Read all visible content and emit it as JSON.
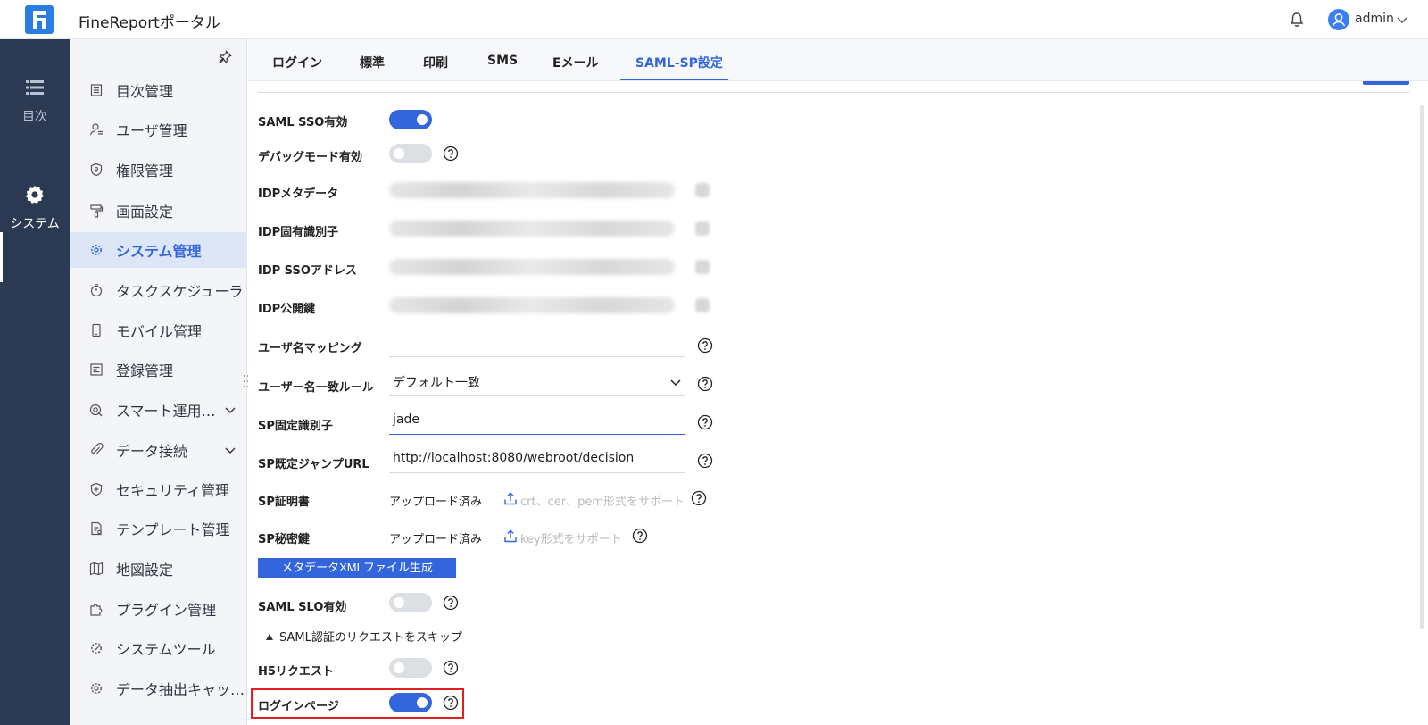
{
  "header": {
    "title": "FineReportポータル",
    "user": "admin"
  },
  "leftnav": {
    "items": [
      {
        "label": "目次",
        "icon": "list-icon"
      },
      {
        "label": "システム",
        "icon": "gear-icon"
      }
    ],
    "active": "システム"
  },
  "sidebar": {
    "items": [
      {
        "label": "目次管理",
        "icon": "list-icon"
      },
      {
        "label": "ユーザ管理",
        "icon": "user-icon"
      },
      {
        "label": "権限管理",
        "icon": "shield-icon"
      },
      {
        "label": "画面設定",
        "icon": "paint-roller-icon"
      },
      {
        "label": "システム管理",
        "icon": "gear-icon"
      },
      {
        "label": "タスクスケジューラ",
        "icon": "timer-icon"
      },
      {
        "label": "モバイル管理",
        "icon": "mobile-icon"
      },
      {
        "label": "登録管理",
        "icon": "register-icon"
      },
      {
        "label": "スマート運用…",
        "icon": "smart-ops-icon"
      },
      {
        "label": "データ接続",
        "icon": "link-icon"
      },
      {
        "label": "セキュリティ管理",
        "icon": "security-icon"
      },
      {
        "label": "テンプレート管理",
        "icon": "template-icon"
      },
      {
        "label": "地図設定",
        "icon": "map-icon"
      },
      {
        "label": "プラグイン管理",
        "icon": "puzzle-icon"
      },
      {
        "label": "システムツール",
        "icon": "tool-icon"
      },
      {
        "label": "データ抽出キャッ…",
        "icon": "gear-icon"
      }
    ],
    "active": "システム管理"
  },
  "tabs": [
    "ログイン",
    "標準",
    "印刷",
    "SMS",
    "Eメール",
    "SAML-SP設定"
  ],
  "active_tab": "SAML-SP設定",
  "form": {
    "saml_sso": {
      "label": "SAML SSO有効",
      "on": true
    },
    "debug_mode": {
      "label": "デバッグモード有効",
      "on": false
    },
    "idp_metadata": {
      "label": "IDPメタデータ"
    },
    "idp_entity_id": {
      "label": "IDP固有識別子"
    },
    "idp_sso_address": {
      "label": "IDP SSOアドレス"
    },
    "idp_public_key": {
      "label": "IDP公開鍵"
    },
    "username_mapping": {
      "label": "ユーザ名マッピング",
      "value": ""
    },
    "username_match_rule": {
      "label": "ユーザー名一致ルール",
      "value": "デフォルト一致"
    },
    "sp_entity_id": {
      "label": "SP固定識別子",
      "value": "jade"
    },
    "sp_default_jump_url": {
      "label": "SP既定ジャンプURL",
      "value": "http://localhost:8080/webroot/decision"
    },
    "sp_certificate": {
      "label": "SP証明書",
      "status": "アップロード済み",
      "hint": "crt、cer、pem形式をサポート"
    },
    "sp_private_key": {
      "label": "SP秘密鍵",
      "status": "アップロード済み",
      "hint": "key形式をサポート"
    },
    "generate_button": "メタデータXMLファイル生成",
    "saml_slo": {
      "label": "SAML SLO有効",
      "on": false
    },
    "skip_section": "SAML認証のリクエストをスキップ",
    "h5_request": {
      "label": "H5リクエスト",
      "on": false
    },
    "login_page": {
      "label": "ログインページ",
      "on": true
    }
  },
  "colors": {
    "accent": "#3366dd",
    "nav_bg": "#2b3a52",
    "highlight": "#e02020"
  }
}
